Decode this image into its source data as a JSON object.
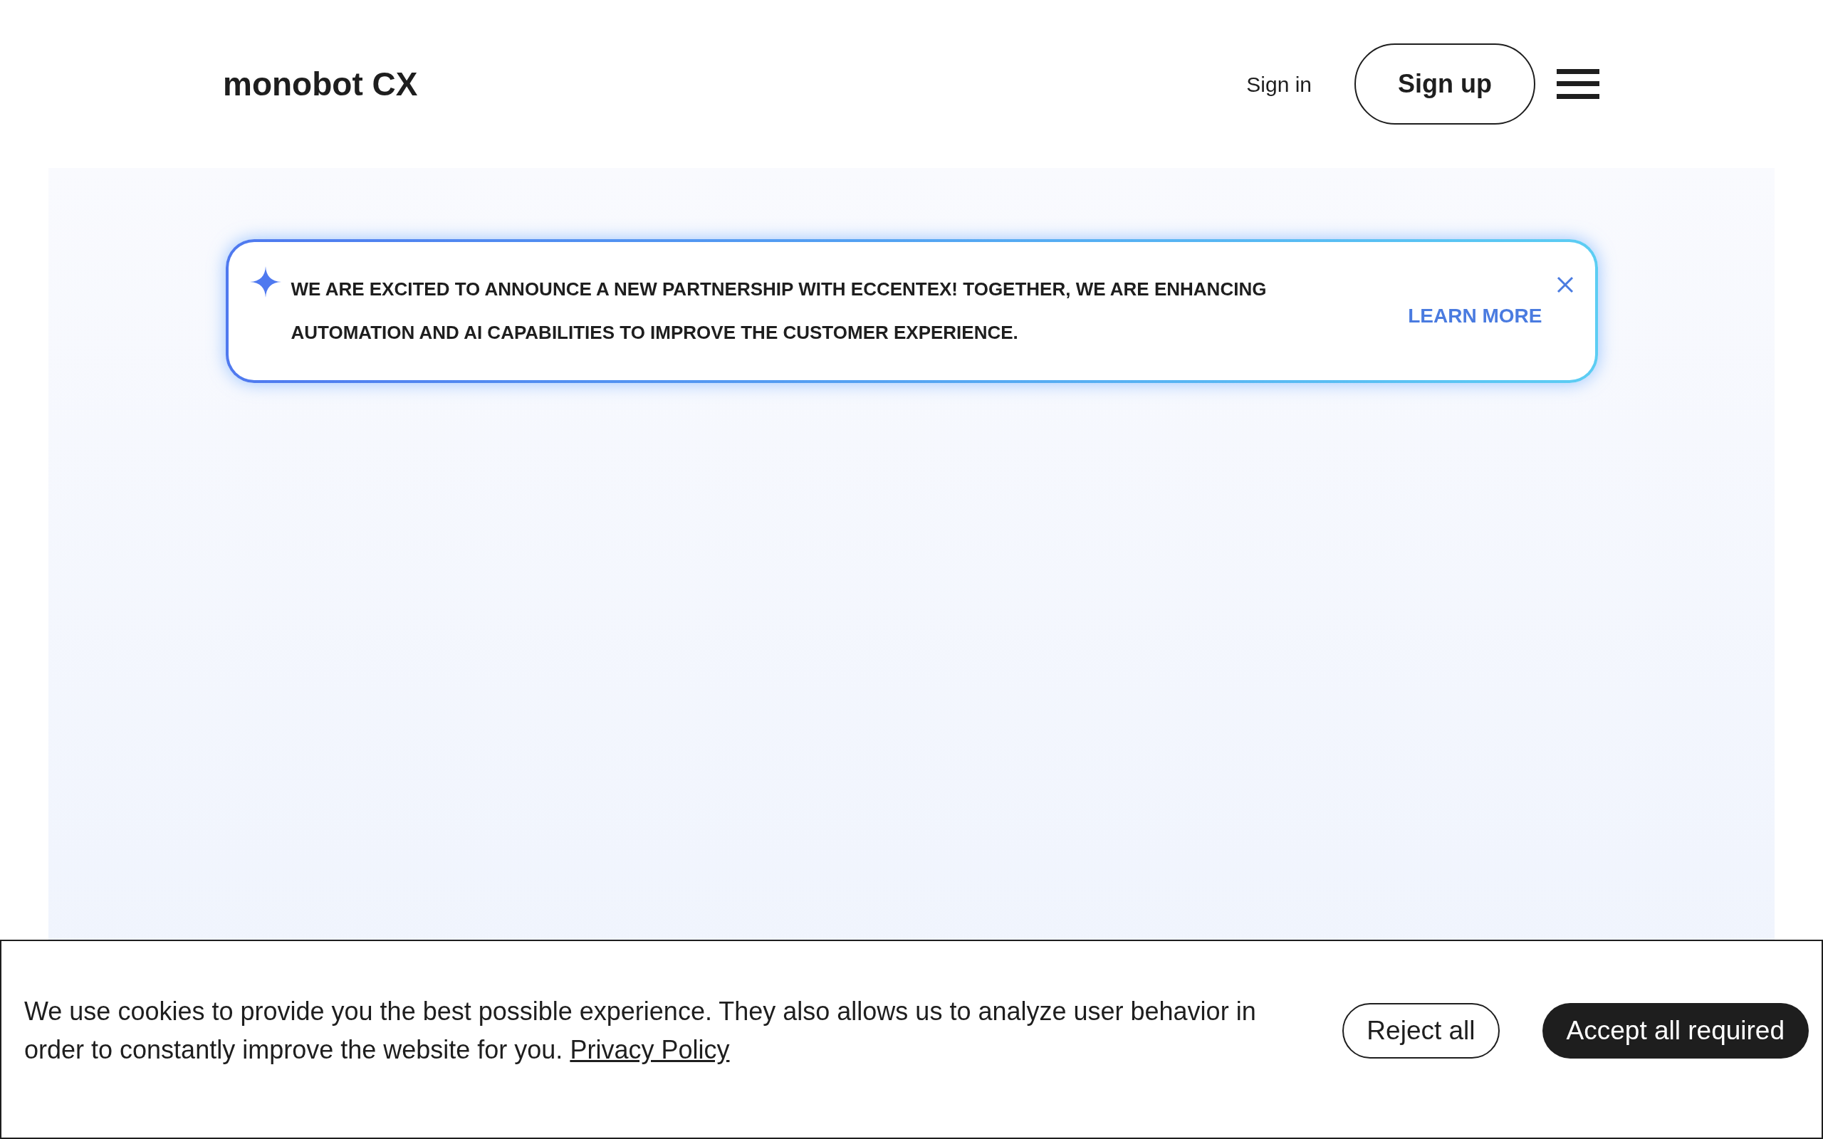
{
  "header": {
    "logo": "monobot CX",
    "sign_in": "Sign in",
    "sign_up": "Sign up"
  },
  "announcement": {
    "text": "WE ARE EXCITED TO ANNOUNCE A NEW PARTNERSHIP WITH ECCENTEX! TOGETHER, WE ARE ENHANCING AUTOMATION AND AI CAPABILITIES TO IMPROVE THE CUSTOMER EXPERIENCE.",
    "link": "LEARN MORE"
  },
  "cookie_banner": {
    "text": "We use cookies to provide you the best possible experience. They also allows us to analyze user behavior in order to constantly improve the website for you.",
    "link": "Privacy Policy",
    "buttons": [
      {
        "label": "Reject all",
        "kind": "outline"
      },
      {
        "label": "Accept all required",
        "kind": "filled"
      }
    ]
  }
}
